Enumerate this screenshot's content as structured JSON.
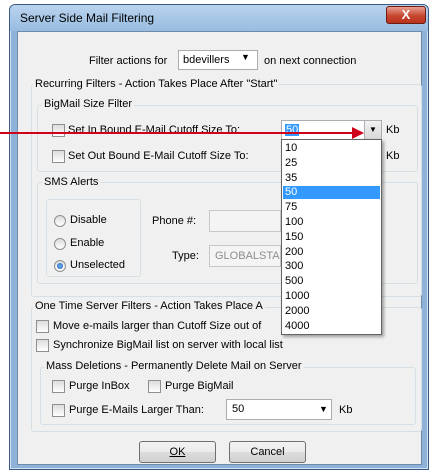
{
  "window": {
    "title": "Server Side Mail Filtering",
    "close_glyph": "X"
  },
  "header": {
    "prefix": "Filter actions for",
    "user": "bdevillers",
    "suffix": "on next connection"
  },
  "recurring": {
    "legend": "Recurring Filters - Action Takes Place After \"Start\"",
    "bigmail": {
      "legend": "BigMail Size Filter",
      "inbound_label": "Set In Bound E-Mail Cutoff Size To:",
      "inbound_value": "50",
      "outbound_label": "Set Out Bound E-Mail Cutoff Size To:",
      "kb": "Kb",
      "options": [
        "10",
        "25",
        "35",
        "50",
        "75",
        "100",
        "150",
        "200",
        "300",
        "500",
        "1000",
        "2000",
        "4000"
      ],
      "selected_option": "50"
    },
    "sms": {
      "legend": "SMS Alerts",
      "disable": "Disable",
      "enable": "Enable",
      "unselected": "Unselected",
      "phone_label": "Phone #:",
      "type_label": "Type:",
      "type_value": "GLOBALSTA"
    }
  },
  "onetime": {
    "legend": "One Time Server Filters  - Action Takes Place A",
    "move_label": "Move e-mails larger than Cutoff Size out of",
    "sync_label": "Synchronize BigMail list on server with local list",
    "mass": {
      "legend": "Mass Deletions - Permanently Delete Mail on Server",
      "purge_inbox": "Purge InBox",
      "purge_bigmail": "Purge BigMail",
      "purge_larger": "Purge E-Mails Larger Than:",
      "purge_value": "50",
      "kb": "Kb"
    }
  },
  "buttons": {
    "ok": "OK",
    "cancel": "Cancel"
  }
}
